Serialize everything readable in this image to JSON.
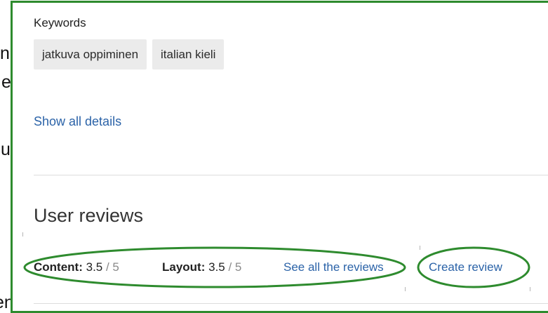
{
  "background_text": {
    "chars": [
      "n",
      "e",
      "u",
      "en"
    ]
  },
  "keywords": {
    "heading": "Keywords",
    "items": [
      "jatkuva oppiminen",
      "italian kieli"
    ]
  },
  "details": {
    "show_all_label": "Show all details"
  },
  "reviews": {
    "heading": "User reviews",
    "content_label": "Content:",
    "content_value": "3.5",
    "content_max": " / 5",
    "layout_label": "Layout:",
    "layout_value": "3.5",
    "layout_max": " / 5",
    "see_all_label": "See all the reviews",
    "create_label": "Create review"
  },
  "colors": {
    "annotation_green": "#2e8b2e",
    "link_blue": "#2b63a8",
    "chip_bg": "#ebebeb"
  }
}
